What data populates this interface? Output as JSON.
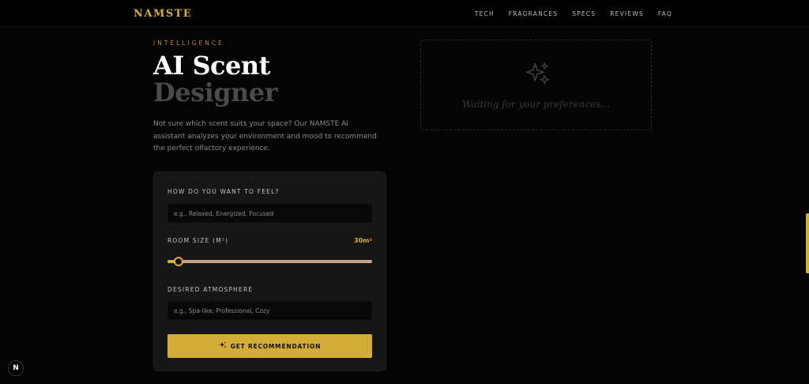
{
  "nav": {
    "brand": "NAMSTE",
    "links": [
      "TECH",
      "FRAGRANCES",
      "SPECS",
      "REVIEWS",
      "FAQ"
    ]
  },
  "hero": {
    "eyebrow": "INTELLIGENCE",
    "title_line1": "AI Scent",
    "title_line2": "Designer",
    "description": "Not sure which scent suits your space? Our NAMSTE AI assistant analyzes your environment and mood to recommend the perfect olfactory experience."
  },
  "form": {
    "feel_label": "HOW DO YOU WANT TO FEEL?",
    "feel_placeholder": "e.g., Relaxed, Energized, Focused",
    "feel_value": "",
    "room_label": "ROOM SIZE (M²)",
    "room_value_text": "30m²",
    "room_size": 30,
    "room_fill_fraction": 0.054,
    "atmosphere_label": "DESIRED ATMOSPHERE",
    "atmosphere_placeholder": "e.g., Spa-like, Professional, Cozy",
    "atmosphere_value": "",
    "cta_label": "GET RECOMMENDATION"
  },
  "result": {
    "waiting_text": "Waiting for your preferences..."
  },
  "badge": {
    "letter": "N"
  },
  "colors": {
    "accent": "#d4ac38",
    "background": "#040404",
    "card": "#161616"
  }
}
